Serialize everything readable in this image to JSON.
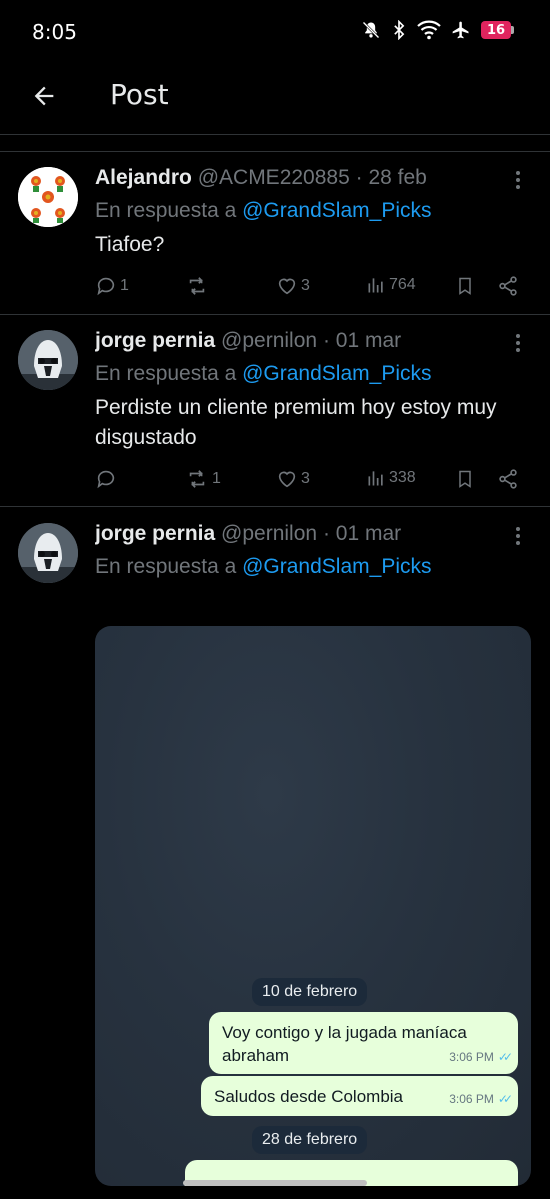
{
  "status_bar": {
    "time": "8:05",
    "battery": "16"
  },
  "header": {
    "title": "Post"
  },
  "posts": [
    {
      "name": "Alejandro",
      "handle": "@ACME220885",
      "date": "28 feb",
      "reply_prefix": "En respuesta a",
      "reply_to": "@GrandSlam_Picks",
      "text": "Tiafoe?",
      "replies": "1",
      "reposts": "",
      "likes": "3",
      "views": "764"
    },
    {
      "name": "jorge pernia",
      "handle": "@pernilon",
      "date": "01 mar",
      "reply_prefix": "En respuesta a",
      "reply_to": "@GrandSlam_Picks",
      "text": "Perdiste un cliente premium hoy estoy muy disgustado",
      "replies": "",
      "reposts": "1",
      "likes": "3",
      "views": "338"
    },
    {
      "name": "jorge pernia",
      "handle": "@pernilon",
      "date": "01 mar",
      "reply_prefix": "En respuesta a",
      "reply_to": "@GrandSlam_Picks"
    }
  ],
  "chat": {
    "date1": "10 de febrero",
    "msg1": "Voy contigo y la jugada maníaca abraham",
    "msg1_time": "3:06 PM",
    "msg2": "Saludos desde Colombia",
    "msg2_time": "3:06 PM",
    "date2": "28 de febrero"
  },
  "colors": {
    "background": "#000000",
    "accent": "#1d9bf0",
    "muted": "#71767b",
    "chat_bubble": "#e7ffdb"
  }
}
